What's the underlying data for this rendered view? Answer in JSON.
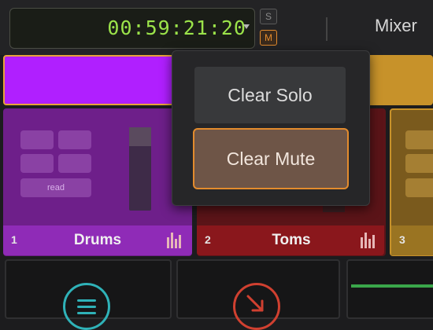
{
  "header": {
    "timecode": "00:59:21:20",
    "solo_label": "S",
    "mute_label": "M",
    "mixer_label": "Mixer"
  },
  "tracks": [
    {
      "number": "1",
      "name": "Drums",
      "color": "#b01fff",
      "automation": "read"
    },
    {
      "number": "2",
      "name": "Toms",
      "color": "#8a171c"
    },
    {
      "number": "3",
      "name": "",
      "color": "#c7922a"
    }
  ],
  "popover": {
    "clear_solo": "Clear Solo",
    "clear_mute": "Clear Mute"
  },
  "colors": {
    "timecode": "#9be34a",
    "accent": "#e38b2d",
    "purple": "#b01fff",
    "red": "#8a171c",
    "gold": "#c7922a",
    "cyan": "#2fb2b8"
  },
  "icons": [
    "timecode-caret-icon",
    "mixer-sliders-icon",
    "list-icon",
    "arrow-icon"
  ]
}
